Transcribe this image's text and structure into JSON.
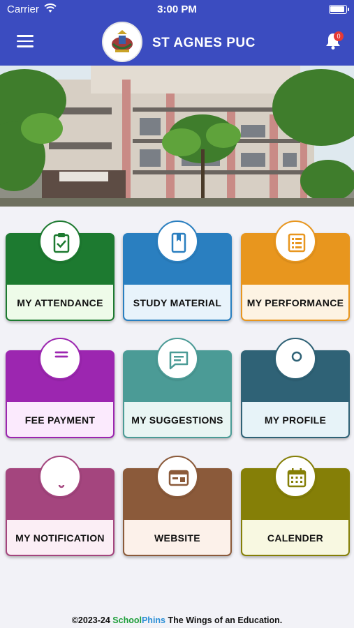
{
  "status_bar": {
    "carrier": "Carrier",
    "time": "3:00 PM"
  },
  "header": {
    "title": "ST AGNES PUC",
    "notification_count": "0"
  },
  "tiles": [
    {
      "label": "MY ATTENDANCE",
      "icon": "clipboard-check-icon",
      "color": "#1d7a30",
      "light": "#eefbe9"
    },
    {
      "label": "STUDY MATERIAL",
      "icon": "book-icon",
      "color": "#2a7fc0",
      "light": "#e8f3fb"
    },
    {
      "label": "MY PERFORMANCE",
      "icon": "report-card-icon",
      "color": "#e8961e",
      "light": "#fdf3e3"
    },
    {
      "label": "FEE PAYMENT",
      "icon": "rupee-icon",
      "color": "#9c26b0",
      "light": "#fbeafd"
    },
    {
      "label": "MY SUGGESTIONS",
      "icon": "chat-message-icon",
      "color": "#4b9b96",
      "light": "#e9f5f3"
    },
    {
      "label": "MY PROFILE",
      "icon": "user-icon",
      "color": "#2f6276",
      "light": "#e7f3f8"
    },
    {
      "label": "MY NOTIFICATION",
      "icon": "bell-icon",
      "color": "#a4457e",
      "light": "#fbeef5"
    },
    {
      "label": "WEBSITE",
      "icon": "browser-window-icon",
      "color": "#8b5a3a",
      "light": "#fcf1ea"
    },
    {
      "label": "CALENDER",
      "icon": "calendar-icon",
      "color": "#857f07",
      "light": "#f8f8e1"
    }
  ],
  "footer": {
    "copyright": "©2023-24",
    "brand_part1": "School",
    "brand_part2": "Phins",
    "tagline": "The Wings of an Education."
  }
}
